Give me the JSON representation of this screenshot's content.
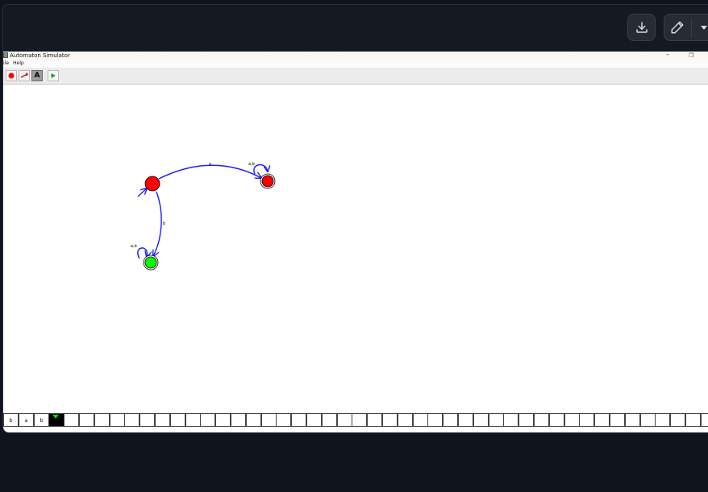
{
  "app": {
    "title": "Automaton Simulator",
    "minimize_glyph": "–",
    "restore_glyph": "❐"
  },
  "menu": [
    {
      "label": "ile"
    },
    {
      "label": "Help"
    }
  ],
  "toolbar": {
    "tools": [
      {
        "name": "add-state-tool",
        "icon": "red-circle-icon"
      },
      {
        "name": "add-transition-tool",
        "icon": "arrow-icon"
      },
      {
        "name": "label-tool",
        "label": "A",
        "active": true
      },
      {
        "name": "run-tool",
        "icon": "play-icon"
      }
    ]
  },
  "automaton": {
    "states": [
      {
        "id": "start",
        "type": "initial",
        "color": "#ff0000"
      },
      {
        "id": "reject",
        "type": "final",
        "color": "#ff0000"
      },
      {
        "id": "accept",
        "type": "final",
        "color": "#00ff00"
      }
    ],
    "transitions": [
      {
        "from": "start",
        "to": "reject",
        "label": "a"
      },
      {
        "from": "reject",
        "to": "reject",
        "label": "a,b"
      },
      {
        "from": "start",
        "to": "accept",
        "label": "b"
      },
      {
        "from": "accept",
        "to": "accept",
        "label": "a,b"
      }
    ],
    "edge_color": "#1a1aff"
  },
  "tape": {
    "cells": [
      "b",
      "a",
      "b",
      "",
      "",
      "",
      "",
      "",
      "",
      "",
      "",
      "",
      "",
      "",
      "",
      "",
      "",
      "",
      "",
      "",
      "",
      "",
      "",
      "",
      "",
      "",
      "",
      "",
      "",
      "",
      "",
      "",
      "",
      "",
      "",
      "",
      "",
      "",
      "",
      "",
      "",
      "",
      "",
      "",
      "",
      "",
      "",
      "",
      "",
      ""
    ],
    "head_index": 3
  },
  "viewer": {
    "actions": [
      {
        "name": "download-button",
        "icon": "download-icon"
      },
      {
        "name": "edit-button",
        "icon": "pencil-icon"
      }
    ]
  },
  "colors": {
    "page_bg": "#10141c",
    "viewer_bg": "#141922",
    "state_red": "#ff0000",
    "state_green": "#00ff00",
    "edge": "#1a1aff",
    "head": "#00e000"
  }
}
